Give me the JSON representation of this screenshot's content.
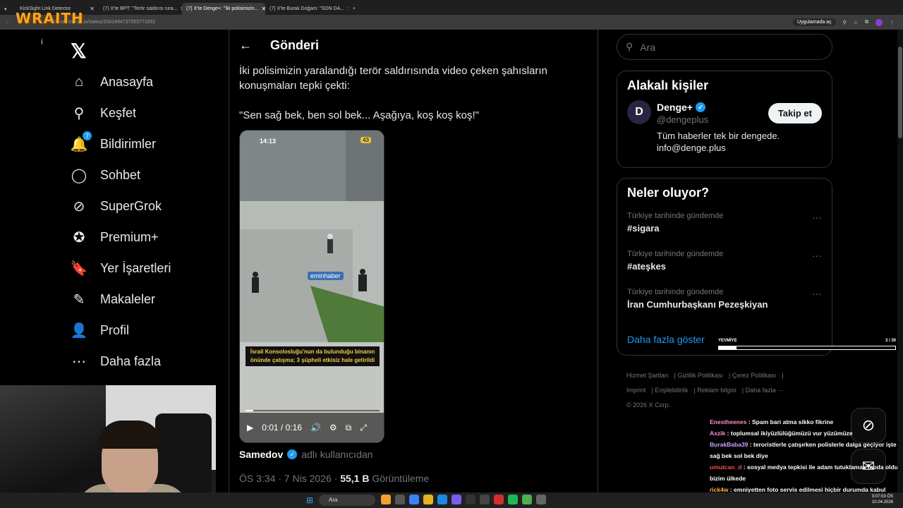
{
  "browser": {
    "tabs": [
      {
        "label": "KickSight Link Detector"
      },
      {
        "label": "(7) X'te BPT: \"Terör saldırısı sıra..."
      },
      {
        "label": "(7) X'te Denge+: \"İki polisimizin..."
      },
      {
        "label": "(7) X'te Burak Doğam: \"SON DA..."
      }
    ],
    "url": "x.com/dengeplus/status/2041494737555771852",
    "open_in_app": "Uygulamada aç"
  },
  "overlay_logo": "WRAITH",
  "nav": {
    "items": [
      {
        "label": "Anasayfa",
        "icon": "home-icon",
        "glyph": "⌂"
      },
      {
        "label": "Keşfet",
        "icon": "search-icon",
        "glyph": "⚲"
      },
      {
        "label": "Bildirimler",
        "icon": "bell-icon",
        "glyph": "🔔",
        "badge": "7"
      },
      {
        "label": "Sohbet",
        "icon": "chat-icon",
        "glyph": "◯"
      },
      {
        "label": "SuperGrok",
        "icon": "grok-icon",
        "glyph": "⊘"
      },
      {
        "label": "Premium+",
        "icon": "premium-icon",
        "glyph": "✪"
      },
      {
        "label": "Yer İşaretleri",
        "icon": "bookmark-icon",
        "glyph": "🔖"
      },
      {
        "label": "Makaleler",
        "icon": "article-icon",
        "glyph": "✎"
      },
      {
        "label": "Profil",
        "icon": "profile-icon",
        "glyph": "👤"
      },
      {
        "label": "Daha fazla",
        "icon": "more-icon",
        "glyph": "⋯"
      }
    ]
  },
  "post": {
    "header": "Gönderi",
    "text_line1": "İki polisimizin yaralandığı terör saldırısında video çeken şahısların konuşmaları tepki çekti:",
    "text_line2": "\"Sen sağ bek, ben sol bek... Aşağıya, koş koş koş!\"",
    "video": {
      "phone_time": "14:13",
      "battery": "43",
      "watermark": "eminhaber",
      "caption": "İsrail Konsolosluğu'nun da bulunduğu binanın önünde çatışma; 3 şüpheli etkisiz hale getirildi",
      "timecode": "0:01 / 0:16",
      "progress": 0.06
    },
    "author_name": "Samedov",
    "author_suffix": "adlı kullanıcıdan",
    "time": "ÖS 3:34 · 7 Nis 2026 ·",
    "views": "55,1 B",
    "views_label": "Görüntüleme"
  },
  "sidebar": {
    "search_placeholder": "Ara",
    "related_title": "Alakalı kişiler",
    "person": {
      "name": "Denge+",
      "handle": "@dengeplus",
      "bio1": "Tüm haberler tek bir dengede.",
      "bio2": "info@denge.plus",
      "follow": "Takip et"
    },
    "trends_title": "Neler oluyor?",
    "trends": [
      {
        "context": "Türkiye tarihinde gündemde",
        "name": "#sigara"
      },
      {
        "context": "Türkiye tarihinde gündemde",
        "name": "#ateşkes"
      },
      {
        "context": "Türkiye tarihinde gündemde",
        "name": "İran Cumhurbaşkanı Pezeşkiyan"
      }
    ],
    "show_more": "Daha fazla göster",
    "footer": [
      "Hizmet Şartları",
      "Gizlilik Politikası",
      "Çerez Politikası",
      "Imprint",
      "Erişilebilirlik",
      "Reklam bilgisi",
      "Daha fazla ···",
      "© 2026 X Corp."
    ]
  },
  "yevmiye": {
    "label": "YEVMİYE",
    "count": "3 / 30",
    "progress": 0.1
  },
  "chat": [
    {
      "user": "Enestheenes",
      "color": "#ff8fd0",
      "msg": "Spam bari atma sikko fikrine"
    },
    {
      "user": "Axzik",
      "color": "#ff8fd0",
      "msg": "toplumsal ikiyüzlülüğümüzü vur yüzümüze"
    },
    {
      "user": "BurakBaba39",
      "color": "#c8a2ff",
      "msg": "teroristlerle çatışırken polislerle dalga geçiyor işte sağ bek sol bek diye"
    },
    {
      "user": "umutcan_d",
      "color": "#ff4d4d",
      "msg": "sosyal medya tepkisi ile adam tutuklamak moda oldu bizim ülkede"
    },
    {
      "user": "rick4w",
      "color": "#ffb347",
      "msg": "emniyetten foto servis edilmesi hiçbir durumda kabul edilmesi gereken bir şey değil"
    }
  ],
  "taskbar": {
    "search": "Ara",
    "time": "3:07:03 ÖS",
    "date": "10.04.2026"
  }
}
